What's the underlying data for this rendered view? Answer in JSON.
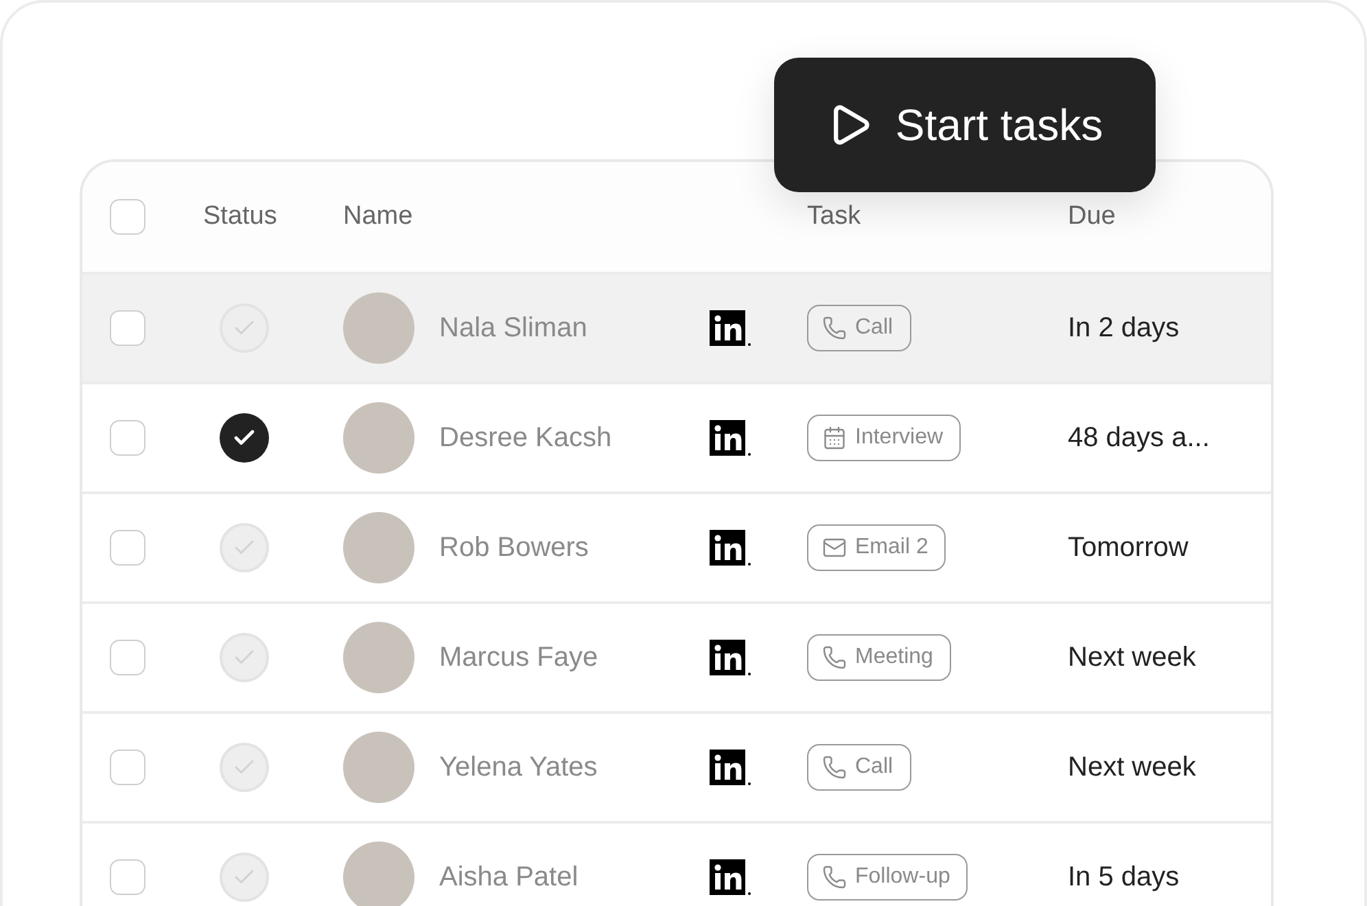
{
  "start_button": {
    "label": "Start tasks"
  },
  "table": {
    "header_checkbox": {
      "checked": false
    },
    "columns": [
      "Status",
      "Name",
      "Task",
      "Due"
    ],
    "rows": [
      {
        "checked": false,
        "selected": true,
        "done": false,
        "name": "Nala Sliman",
        "task": {
          "kind": "phone",
          "label": "Call"
        },
        "due": "In 2 days"
      },
      {
        "checked": false,
        "selected": false,
        "done": true,
        "name": "Desree Kacsh",
        "task": {
          "kind": "calendar",
          "label": "Interview"
        },
        "due": "48 days a..."
      },
      {
        "checked": false,
        "selected": false,
        "done": false,
        "name": "Rob Bowers",
        "task": {
          "kind": "mail",
          "label": "Email 2"
        },
        "due": "Tomorrow"
      },
      {
        "checked": false,
        "selected": false,
        "done": false,
        "name": "Marcus Faye",
        "task": {
          "kind": "phone",
          "label": "Meeting"
        },
        "due": "Next week"
      },
      {
        "checked": false,
        "selected": false,
        "done": false,
        "name": "Yelena Yates",
        "task": {
          "kind": "phone",
          "label": "Call"
        },
        "due": "Next week"
      },
      {
        "checked": false,
        "selected": false,
        "done": false,
        "name": "Aisha Patel",
        "task": {
          "kind": "phone",
          "label": "Follow-up"
        },
        "due": "In 5 days"
      }
    ]
  }
}
